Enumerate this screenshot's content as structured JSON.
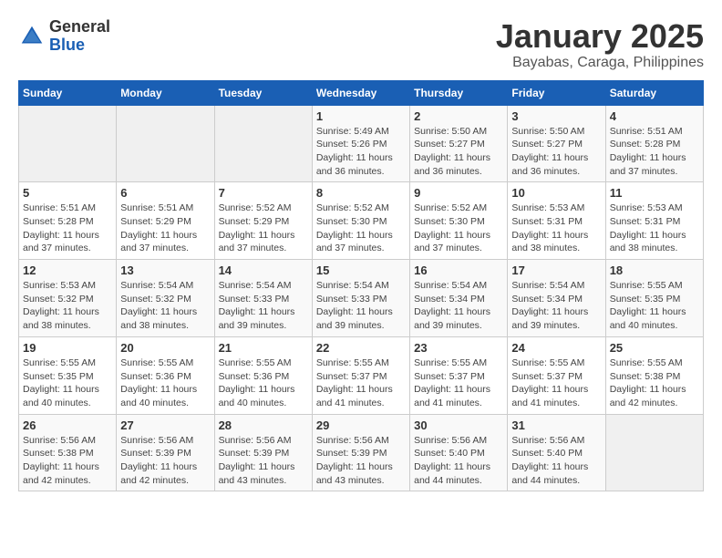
{
  "logo": {
    "general": "General",
    "blue": "Blue"
  },
  "title": "January 2025",
  "location": "Bayabas, Caraga, Philippines",
  "days_of_week": [
    "Sunday",
    "Monday",
    "Tuesday",
    "Wednesday",
    "Thursday",
    "Friday",
    "Saturday"
  ],
  "weeks": [
    [
      {
        "day": "",
        "info": ""
      },
      {
        "day": "",
        "info": ""
      },
      {
        "day": "",
        "info": ""
      },
      {
        "day": "1",
        "info": "Sunrise: 5:49 AM\nSunset: 5:26 PM\nDaylight: 11 hours and 36 minutes."
      },
      {
        "day": "2",
        "info": "Sunrise: 5:50 AM\nSunset: 5:27 PM\nDaylight: 11 hours and 36 minutes."
      },
      {
        "day": "3",
        "info": "Sunrise: 5:50 AM\nSunset: 5:27 PM\nDaylight: 11 hours and 36 minutes."
      },
      {
        "day": "4",
        "info": "Sunrise: 5:51 AM\nSunset: 5:28 PM\nDaylight: 11 hours and 37 minutes."
      }
    ],
    [
      {
        "day": "5",
        "info": "Sunrise: 5:51 AM\nSunset: 5:28 PM\nDaylight: 11 hours and 37 minutes."
      },
      {
        "day": "6",
        "info": "Sunrise: 5:51 AM\nSunset: 5:29 PM\nDaylight: 11 hours and 37 minutes."
      },
      {
        "day": "7",
        "info": "Sunrise: 5:52 AM\nSunset: 5:29 PM\nDaylight: 11 hours and 37 minutes."
      },
      {
        "day": "8",
        "info": "Sunrise: 5:52 AM\nSunset: 5:30 PM\nDaylight: 11 hours and 37 minutes."
      },
      {
        "day": "9",
        "info": "Sunrise: 5:52 AM\nSunset: 5:30 PM\nDaylight: 11 hours and 37 minutes."
      },
      {
        "day": "10",
        "info": "Sunrise: 5:53 AM\nSunset: 5:31 PM\nDaylight: 11 hours and 38 minutes."
      },
      {
        "day": "11",
        "info": "Sunrise: 5:53 AM\nSunset: 5:31 PM\nDaylight: 11 hours and 38 minutes."
      }
    ],
    [
      {
        "day": "12",
        "info": "Sunrise: 5:53 AM\nSunset: 5:32 PM\nDaylight: 11 hours and 38 minutes."
      },
      {
        "day": "13",
        "info": "Sunrise: 5:54 AM\nSunset: 5:32 PM\nDaylight: 11 hours and 38 minutes."
      },
      {
        "day": "14",
        "info": "Sunrise: 5:54 AM\nSunset: 5:33 PM\nDaylight: 11 hours and 39 minutes."
      },
      {
        "day": "15",
        "info": "Sunrise: 5:54 AM\nSunset: 5:33 PM\nDaylight: 11 hours and 39 minutes."
      },
      {
        "day": "16",
        "info": "Sunrise: 5:54 AM\nSunset: 5:34 PM\nDaylight: 11 hours and 39 minutes."
      },
      {
        "day": "17",
        "info": "Sunrise: 5:54 AM\nSunset: 5:34 PM\nDaylight: 11 hours and 39 minutes."
      },
      {
        "day": "18",
        "info": "Sunrise: 5:55 AM\nSunset: 5:35 PM\nDaylight: 11 hours and 40 minutes."
      }
    ],
    [
      {
        "day": "19",
        "info": "Sunrise: 5:55 AM\nSunset: 5:35 PM\nDaylight: 11 hours and 40 minutes."
      },
      {
        "day": "20",
        "info": "Sunrise: 5:55 AM\nSunset: 5:36 PM\nDaylight: 11 hours and 40 minutes."
      },
      {
        "day": "21",
        "info": "Sunrise: 5:55 AM\nSunset: 5:36 PM\nDaylight: 11 hours and 40 minutes."
      },
      {
        "day": "22",
        "info": "Sunrise: 5:55 AM\nSunset: 5:37 PM\nDaylight: 11 hours and 41 minutes."
      },
      {
        "day": "23",
        "info": "Sunrise: 5:55 AM\nSunset: 5:37 PM\nDaylight: 11 hours and 41 minutes."
      },
      {
        "day": "24",
        "info": "Sunrise: 5:55 AM\nSunset: 5:37 PM\nDaylight: 11 hours and 41 minutes."
      },
      {
        "day": "25",
        "info": "Sunrise: 5:55 AM\nSunset: 5:38 PM\nDaylight: 11 hours and 42 minutes."
      }
    ],
    [
      {
        "day": "26",
        "info": "Sunrise: 5:56 AM\nSunset: 5:38 PM\nDaylight: 11 hours and 42 minutes."
      },
      {
        "day": "27",
        "info": "Sunrise: 5:56 AM\nSunset: 5:39 PM\nDaylight: 11 hours and 42 minutes."
      },
      {
        "day": "28",
        "info": "Sunrise: 5:56 AM\nSunset: 5:39 PM\nDaylight: 11 hours and 43 minutes."
      },
      {
        "day": "29",
        "info": "Sunrise: 5:56 AM\nSunset: 5:39 PM\nDaylight: 11 hours and 43 minutes."
      },
      {
        "day": "30",
        "info": "Sunrise: 5:56 AM\nSunset: 5:40 PM\nDaylight: 11 hours and 44 minutes."
      },
      {
        "day": "31",
        "info": "Sunrise: 5:56 AM\nSunset: 5:40 PM\nDaylight: 11 hours and 44 minutes."
      },
      {
        "day": "",
        "info": ""
      }
    ]
  ]
}
